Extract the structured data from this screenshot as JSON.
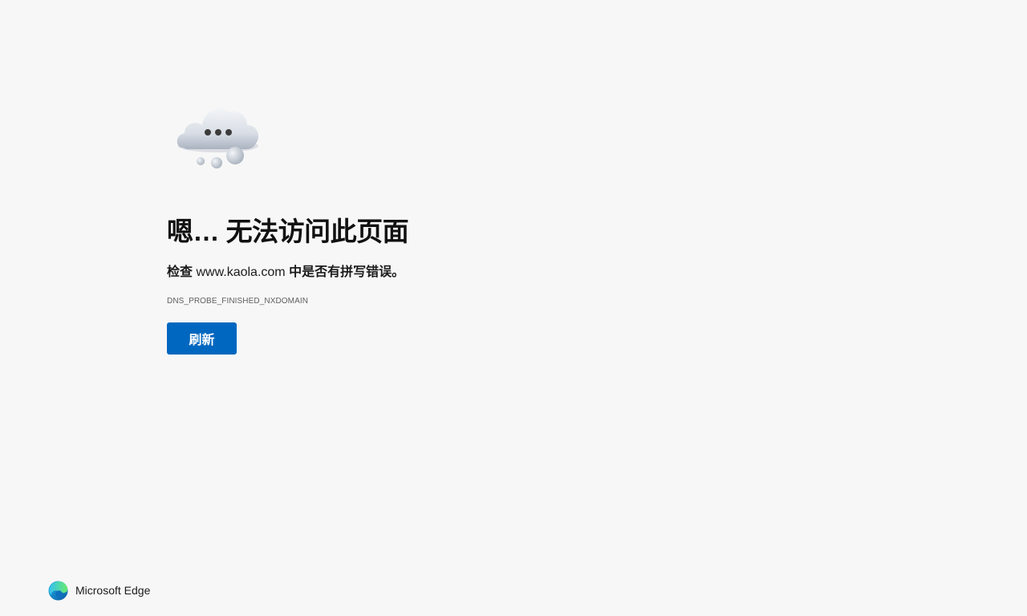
{
  "error_page": {
    "illustration_icon": "cloud-thinking-icon",
    "headline": "嗯… 无法访问此页面",
    "suggestion_prefix": "检查",
    "domain": "www.kaola.com",
    "suggestion_suffix": "中是否有拼写错误。",
    "error_code": "DNS_PROBE_FINISHED_NXDOMAIN",
    "refresh_label": "刷新",
    "button_color": "#0067c0"
  },
  "footer": {
    "brand_icon": "edge-logo-icon",
    "brand_name": "Microsoft Edge"
  }
}
